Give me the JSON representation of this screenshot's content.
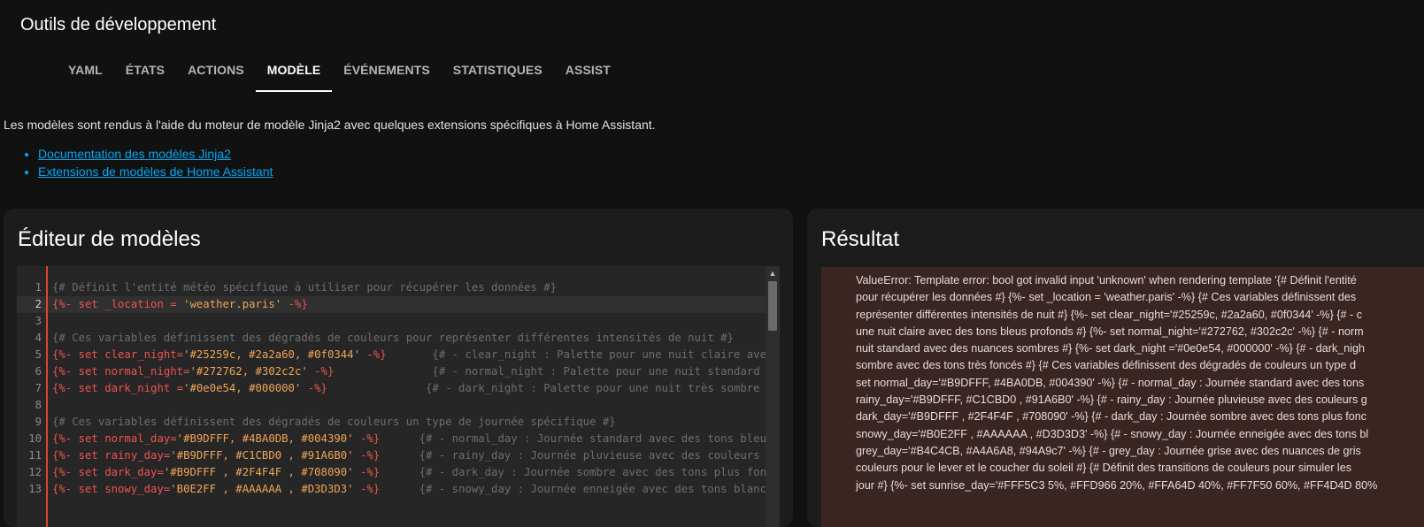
{
  "app": {
    "title": "Outils de développement"
  },
  "tabs": [
    {
      "label": "YAML",
      "active": false
    },
    {
      "label": "ÉTATS",
      "active": false
    },
    {
      "label": "ACTIONS",
      "active": false
    },
    {
      "label": "MODÈLE",
      "active": true
    },
    {
      "label": "ÉVÉNEMENTS",
      "active": false
    },
    {
      "label": "STATISTIQUES",
      "active": false
    },
    {
      "label": "ASSIST",
      "active": false
    }
  ],
  "intro": {
    "text": "Les modèles sont rendus à l'aide du moteur de modèle Jinja2 avec quelques extensions spécifiques à Home Assistant.",
    "links": [
      "Documentation des modèles Jinja2",
      "Extensions de modèles de Home Assistant"
    ]
  },
  "editor": {
    "title": "Éditeur de modèles",
    "active_line": 2,
    "lines": [
      {
        "num": "1",
        "segments": [
          {
            "cls": "c-comment",
            "text": "{# Définit l'entité météo spécifique à utiliser pour récupérer les données #}"
          }
        ]
      },
      {
        "num": "2",
        "segments": [
          {
            "cls": "c-tag",
            "text": "{%- set _location = "
          },
          {
            "cls": "c-str",
            "text": "'weather.paris'"
          },
          {
            "cls": "c-tag",
            "text": " -%}"
          }
        ]
      },
      {
        "num": "3",
        "segments": []
      },
      {
        "num": "4",
        "segments": [
          {
            "cls": "c-comment",
            "text": "{# Ces variables définissent des dégradés de couleurs pour représenter différentes intensités de nuit #}"
          }
        ]
      },
      {
        "num": "5",
        "segments": [
          {
            "cls": "c-tag",
            "text": "{%- set clear_night="
          },
          {
            "cls": "c-str",
            "text": "'#25259c, #2a2a60, #0f0344'"
          },
          {
            "cls": "c-tag",
            "text": " -%}"
          },
          {
            "cls": "c-comment",
            "text": "       {# - clear_night : Palette pour une nuit claire avec des tons bleus profonds #}"
          }
        ]
      },
      {
        "num": "6",
        "segments": [
          {
            "cls": "c-tag",
            "text": "{%- set normal_night="
          },
          {
            "cls": "c-str",
            "text": "'#272762, #302c2c'"
          },
          {
            "cls": "c-tag",
            "text": " -%}"
          },
          {
            "cls": "c-comment",
            "text": "               {# - normal_night : Palette pour une nuit standard avec des nuances sombres #}"
          }
        ]
      },
      {
        "num": "7",
        "segments": [
          {
            "cls": "c-tag",
            "text": "{%- set dark_night ="
          },
          {
            "cls": "c-str",
            "text": "'#0e0e54, #000000'"
          },
          {
            "cls": "c-tag",
            "text": " -%}"
          },
          {
            "cls": "c-comment",
            "text": "               {# - dark_night : Palette pour une nuit très sombre avec des tons très foncés #}"
          }
        ]
      },
      {
        "num": "8",
        "segments": []
      },
      {
        "num": "9",
        "segments": [
          {
            "cls": "c-comment",
            "text": "{# Ces variables définissent des dégradés de couleurs un type de journée spécifique #}"
          }
        ]
      },
      {
        "num": "10",
        "segments": [
          {
            "cls": "c-tag",
            "text": "{%- set normal_day="
          },
          {
            "cls": "c-str",
            "text": "'#B9DFFF, #4BA0DB, #004390'"
          },
          {
            "cls": "c-tag",
            "text": " -%}"
          },
          {
            "cls": "c-comment",
            "text": "      {# - normal_day : Journée standard avec des tons bleus #}"
          }
        ]
      },
      {
        "num": "11",
        "segments": [
          {
            "cls": "c-tag",
            "text": "{%- set rainy_day="
          },
          {
            "cls": "c-str",
            "text": "'#B9DFFF, #C1CBD0 , #91A6B0'"
          },
          {
            "cls": "c-tag",
            "text": " -%}"
          },
          {
            "cls": "c-comment",
            "text": "      {# - rainy_day : Journée pluvieuse avec des couleurs grises #}"
          }
        ]
      },
      {
        "num": "12",
        "segments": [
          {
            "cls": "c-tag",
            "text": "{%- set dark_day="
          },
          {
            "cls": "c-str",
            "text": "'#B9DFFF , #2F4F4F , #708090'"
          },
          {
            "cls": "c-tag",
            "text": " -%}"
          },
          {
            "cls": "c-comment",
            "text": "      {# - dark_day : Journée sombre avec des tons plus foncés #}"
          }
        ]
      },
      {
        "num": "13",
        "segments": [
          {
            "cls": "c-tag",
            "text": "{%- set snowy_day="
          },
          {
            "cls": "c-str",
            "text": "'B0E2FF , #AAAAAA , #D3D3D3'"
          },
          {
            "cls": "c-tag",
            "text": " -%}"
          },
          {
            "cls": "c-comment",
            "text": "      {# - snowy_day : Journée enneigée avec des tons blancs #}"
          }
        ]
      }
    ]
  },
  "result": {
    "title": "Résultat",
    "error_lines": [
      "ValueError: Template error: bool got invalid input 'unknown' when rendering template '{# Définit l'entité",
      "pour récupérer les données #} {%- set _location = 'weather.paris' -%} {# Ces variables définissent des",
      "représenter différentes intensités de nuit #} {%- set clear_night='#25259c, #2a2a60, #0f0344' -%} {# - c",
      "une nuit claire avec des tons bleus profonds #} {%- set normal_night='#272762, #302c2c' -%} {# - norm",
      "nuit standard avec des nuances sombres #} {%- set dark_night ='#0e0e54, #000000' -%} {# - dark_nigh",
      "sombre avec des tons très foncés #} {# Ces variables définissent des dégradés de couleurs un type d",
      "set normal_day='#B9DFFF, #4BA0DB, #004390' -%} {# - normal_day : Journée standard avec des tons",
      "rainy_day='#B9DFFF, #C1CBD0 , #91A6B0' -%} {# - rainy_day : Journée pluvieuse avec des couleurs g",
      "dark_day='#B9DFFF , #2F4F4F , #708090' -%} {# - dark_day : Journée sombre avec des tons plus fonc",
      "snowy_day='#B0E2FF , #AAAAAA , #D3D3D3' -%} {# - snowy_day : Journée enneigée avec des tons bl",
      "grey_day='#B4C4CB, #A4A6A8, #94A9c7' -%} {# - grey_day : Journée grise avec des nuances de gris",
      "couleurs pour le lever et le coucher du soleil #} {# Définit des transitions de couleurs pour simuler les",
      "jour #} {%- set sunrise_day='#FFF5C3 5%, #FFD966 20%, #FFA64D 40%, #FF7F50 60%, #FF4D4D 80%"
    ]
  },
  "colors": {
    "background": "#111111",
    "card": "#1c1c1c",
    "editor_bg": "#262626",
    "error_bg": "#3a2523",
    "accent_link": "#03a9f4",
    "jinja_tag": "#ef5350",
    "string": "#f0a458",
    "comment": "#6d6d6d"
  }
}
